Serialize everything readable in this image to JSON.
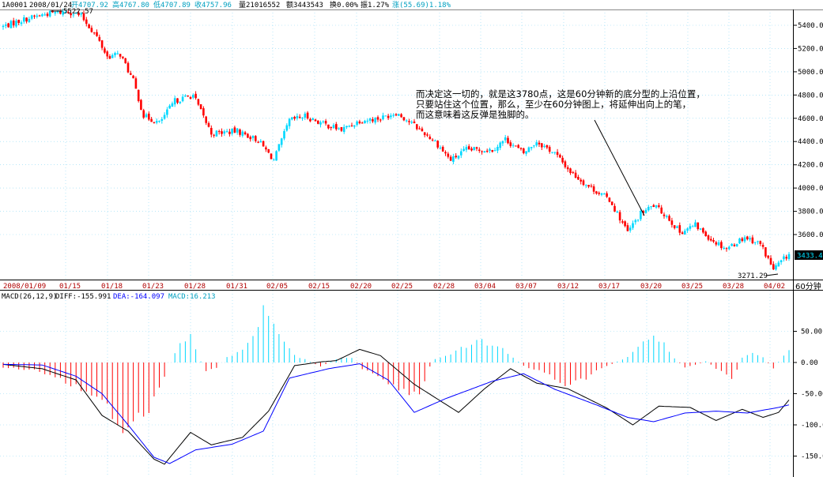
{
  "header": {
    "code": "1A0001",
    "date": "2008/01/24",
    "open_label": "开4707.92",
    "high_label": "高4767.80",
    "low_label": "低4707.89",
    "close_label": "收4757.96",
    "volume_label": "量21016552",
    "amount_label": "额3443543",
    "turnover_label": "换0.00%",
    "amplitude_label": "振1.27%",
    "change_label": "涨(55.69)1.18%"
  },
  "annotation": {
    "lines": [
      "而决定这一切的，就是这3780点，这是60分钟新的底分型的上沿位置，",
      "只要站住这个位置，那么，至少在60分钟图上，将延伸出向上的笔，",
      "而这意味着这反弹是独脚的。"
    ]
  },
  "price_axis": {
    "ticks": [
      "5400.00",
      "5200.00",
      "5000.00",
      "4800.00",
      "4600.00",
      "4400.00",
      "4200.00",
      "4000.00",
      "3800.00",
      "3600.00"
    ],
    "current_price": "3433.4"
  },
  "markers": {
    "high": "5522.57",
    "low": "3271.29"
  },
  "date_axis": {
    "labels": [
      "2008/01/09",
      "01/15",
      "01/18",
      "01/23",
      "01/28",
      "01/31",
      "02/05",
      "02/15",
      "02/20",
      "02/25",
      "02/28",
      "03/04",
      "03/07",
      "03/12",
      "03/17",
      "03/20",
      "03/25",
      "03/28",
      "04/02"
    ],
    "period": "60分钟"
  },
  "macd": {
    "params": "MACD(26,12,9)",
    "diff_label": "DIFF:-155.991",
    "dea_label": "DEA:-164.097",
    "macd_label": "MACD:16.213",
    "ticks": [
      "50.00",
      "0.00",
      "-50.00",
      "-100.00",
      "-150.00"
    ]
  },
  "colors": {
    "up": "#00d8ff",
    "down": "#ff0000",
    "grid": "#8ad8f4",
    "diff": "#000000",
    "dea": "#0000ff",
    "header": "#0000c0"
  },
  "chart_data": [
    {
      "type": "candlestick",
      "title": "1A0001 60分钟",
      "ylim": [
        3270,
        5560
      ],
      "x_dates": [
        "2008/01/09",
        "01/15",
        "01/18",
        "01/23",
        "01/28",
        "01/31",
        "02/05",
        "02/15",
        "02/20",
        "02/25",
        "02/28",
        "03/04",
        "03/07",
        "03/12",
        "03/17",
        "03/20",
        "03/25",
        "03/28",
        "04/02"
      ],
      "close_anchors": [
        [
          0,
          5390
        ],
        [
          8,
          5450
        ],
        [
          17,
          5500
        ],
        [
          25,
          5520
        ],
        [
          30,
          5480
        ],
        [
          36,
          5300
        ],
        [
          40,
          5130
        ],
        [
          45,
          5150
        ],
        [
          50,
          4920
        ],
        [
          54,
          4620
        ],
        [
          60,
          4560
        ],
        [
          66,
          4750
        ],
        [
          73,
          4800
        ],
        [
          80,
          4470
        ],
        [
          90,
          4490
        ],
        [
          98,
          4410
        ],
        [
          104,
          4240
        ],
        [
          110,
          4580
        ],
        [
          116,
          4620
        ],
        [
          122,
          4560
        ],
        [
          130,
          4500
        ],
        [
          137,
          4580
        ],
        [
          145,
          4600
        ],
        [
          151,
          4650
        ],
        [
          158,
          4540
        ],
        [
          166,
          4400
        ],
        [
          172,
          4240
        ],
        [
          178,
          4330
        ],
        [
          188,
          4330
        ],
        [
          193,
          4420
        ],
        [
          200,
          4300
        ],
        [
          205,
          4400
        ],
        [
          212,
          4300
        ],
        [
          218,
          4140
        ],
        [
          224,
          4030
        ],
        [
          233,
          3900
        ],
        [
          240,
          3620
        ],
        [
          245,
          3780
        ],
        [
          250,
          3850
        ],
        [
          255,
          3760
        ],
        [
          260,
          3620
        ],
        [
          266,
          3680
        ],
        [
          272,
          3560
        ],
        [
          278,
          3480
        ],
        [
          285,
          3580
        ],
        [
          291,
          3520
        ],
        [
          296,
          3300
        ],
        [
          302,
          3433
        ]
      ],
      "high": 5522.57,
      "low": 3271.29,
      "last_close": 3433.4
    },
    {
      "type": "line",
      "title": "MACD(26,12,9)",
      "ylim": [
        -170,
        100
      ],
      "series": [
        {
          "name": "DIFF",
          "anchors": [
            [
              0,
              -3
            ],
            [
              15,
              -10
            ],
            [
              28,
              -28
            ],
            [
              38,
              -85
            ],
            [
              48,
              -110
            ],
            [
              58,
              -155
            ],
            [
              62,
              -163
            ],
            [
              72,
              -112
            ],
            [
              80,
              -132
            ],
            [
              92,
              -120
            ],
            [
              102,
              -78
            ],
            [
              112,
              -5
            ],
            [
              122,
              1
            ],
            [
              128,
              3
            ],
            [
              137,
              21
            ],
            [
              145,
              11
            ],
            [
              158,
              -35
            ],
            [
              175,
              -80
            ],
            [
              185,
              -42
            ],
            [
              195,
              -10
            ],
            [
              205,
              -33
            ],
            [
              217,
              -42
            ],
            [
              232,
              -73
            ],
            [
              242,
              -100
            ],
            [
              252,
              -70
            ],
            [
              264,
              -72
            ],
            [
              274,
              -93
            ],
            [
              284,
              -75
            ],
            [
              292,
              -88
            ],
            [
              298,
              -80
            ],
            [
              302,
              -60
            ]
          ]
        },
        {
          "name": "DEA",
          "anchors": [
            [
              0,
              -3
            ],
            [
              15,
              -4
            ],
            [
              28,
              -22
            ],
            [
              38,
              -50
            ],
            [
              48,
              -100
            ],
            [
              58,
              -152
            ],
            [
              64,
              -162
            ],
            [
              74,
              -140
            ],
            [
              88,
              -131
            ],
            [
              100,
              -110
            ],
            [
              110,
              -25
            ],
            [
              125,
              -10
            ],
            [
              137,
              -2
            ],
            [
              148,
              -28
            ],
            [
              158,
              -80
            ],
            [
              170,
              -58
            ],
            [
              188,
              -30
            ],
            [
              200,
              -18
            ],
            [
              212,
              -43
            ],
            [
              228,
              -68
            ],
            [
              240,
              -88
            ],
            [
              250,
              -95
            ],
            [
              262,
              -81
            ],
            [
              274,
              -78
            ],
            [
              286,
              -81
            ],
            [
              298,
              -72
            ],
            [
              302,
              -68
            ]
          ]
        }
      ],
      "hist_anchors": [
        [
          0,
          -8
        ],
        [
          14,
          -14
        ],
        [
          24,
          -30
        ],
        [
          32,
          -45
        ],
        [
          40,
          -70
        ],
        [
          48,
          -108
        ],
        [
          54,
          -88
        ],
        [
          60,
          -40
        ],
        [
          64,
          0
        ],
        [
          68,
          32
        ],
        [
          72,
          43
        ],
        [
          75,
          10
        ],
        [
          78,
          -15
        ],
        [
          82,
          -8
        ],
        [
          86,
          8
        ],
        [
          92,
          22
        ],
        [
          98,
          50
        ],
        [
          100,
          85
        ],
        [
          104,
          70
        ],
        [
          108,
          30
        ],
        [
          112,
          12
        ],
        [
          122,
          -6
        ],
        [
          128,
          5
        ],
        [
          134,
          8
        ],
        [
          138,
          -10
        ],
        [
          144,
          -22
        ],
        [
          150,
          -35
        ],
        [
          156,
          -55
        ],
        [
          160,
          -50
        ],
        [
          165,
          4
        ],
        [
          170,
          10
        ],
        [
          176,
          25
        ],
        [
          184,
          35
        ],
        [
          192,
          22
        ],
        [
          196,
          8
        ],
        [
          200,
          -6
        ],
        [
          206,
          -12
        ],
        [
          212,
          -26
        ],
        [
          216,
          -35
        ],
        [
          222,
          -30
        ],
        [
          228,
          -12
        ],
        [
          234,
          -2
        ],
        [
          240,
          8
        ],
        [
          246,
          30
        ],
        [
          250,
          40
        ],
        [
          254,
          30
        ],
        [
          258,
          6
        ],
        [
          262,
          -8
        ],
        [
          266,
          -4
        ],
        [
          270,
          2
        ],
        [
          276,
          -15
        ],
        [
          280,
          -30
        ],
        [
          284,
          8
        ],
        [
          288,
          14
        ],
        [
          292,
          8
        ],
        [
          296,
          -10
        ],
        [
          300,
          12
        ],
        [
          302,
          18
        ]
      ]
    }
  ]
}
